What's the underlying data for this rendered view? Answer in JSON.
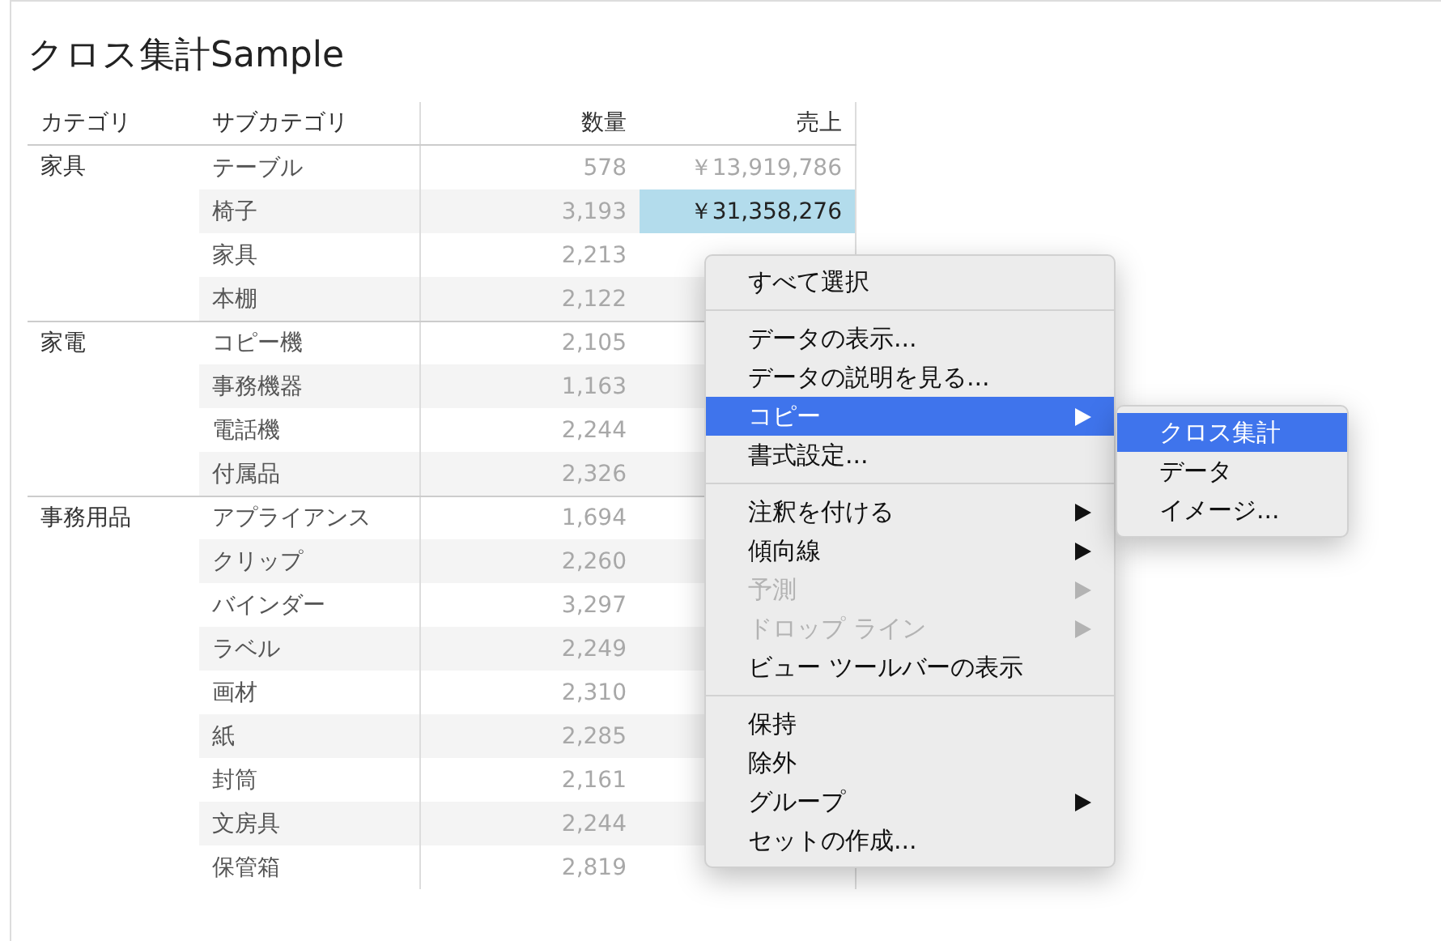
{
  "title": "クロス集計Sample",
  "table": {
    "columns": [
      "カテゴリ",
      "サブカテゴリ",
      "数量",
      "売上"
    ],
    "groups": [
      {
        "category": "家具",
        "rows": [
          {
            "subcategory": "テーブル",
            "quantity": "578",
            "sales": "￥13,919,786",
            "selected": false
          },
          {
            "subcategory": "椅子",
            "quantity": "3,193",
            "sales": "￥31,358,276",
            "selected": true
          },
          {
            "subcategory": "家具",
            "quantity": "2,213",
            "selected": false
          },
          {
            "subcategory": "本棚",
            "quantity": "2,122",
            "selected": false
          }
        ]
      },
      {
        "category": "家電",
        "rows": [
          {
            "subcategory": "コピー機",
            "quantity": "2,105",
            "selected": false
          },
          {
            "subcategory": "事務機器",
            "quantity": "1,163",
            "selected": false
          },
          {
            "subcategory": "電話機",
            "quantity": "2,244",
            "selected": false
          },
          {
            "subcategory": "付属品",
            "quantity": "2,326",
            "selected": false
          }
        ]
      },
      {
        "category": "事務用品",
        "rows": [
          {
            "subcategory": "アプライアンス",
            "quantity": "1,694",
            "selected": false
          },
          {
            "subcategory": "クリップ",
            "quantity": "2,260",
            "selected": false
          },
          {
            "subcategory": "バインダー",
            "quantity": "3,297",
            "selected": false
          },
          {
            "subcategory": "ラベル",
            "quantity": "2,249",
            "selected": false
          },
          {
            "subcategory": "画材",
            "quantity": "2,310",
            "selected": false
          },
          {
            "subcategory": "紙",
            "quantity": "2,285",
            "selected": false
          },
          {
            "subcategory": "封筒",
            "quantity": "2,161",
            "selected": false
          },
          {
            "subcategory": "文房具",
            "quantity": "2,244",
            "selected": false
          },
          {
            "subcategory": "保管箱",
            "quantity": "2,819",
            "selected": false
          }
        ]
      }
    ]
  },
  "context_menu": {
    "items": [
      {
        "kind": "item",
        "label": "すべて選択",
        "disabled": false,
        "selected": false,
        "submenu": false
      },
      {
        "kind": "separator"
      },
      {
        "kind": "item",
        "label": "データの表示...",
        "disabled": false,
        "selected": false,
        "submenu": false
      },
      {
        "kind": "item",
        "label": "データの説明を見る...",
        "disabled": false,
        "selected": false,
        "submenu": false
      },
      {
        "kind": "item",
        "label": "コピー",
        "disabled": false,
        "selected": true,
        "submenu": true
      },
      {
        "kind": "item",
        "label": "書式設定...",
        "disabled": false,
        "selected": false,
        "submenu": false
      },
      {
        "kind": "separator"
      },
      {
        "kind": "item",
        "label": "注釈を付ける",
        "disabled": false,
        "selected": false,
        "submenu": true
      },
      {
        "kind": "item",
        "label": "傾向線",
        "disabled": false,
        "selected": false,
        "submenu": true
      },
      {
        "kind": "item",
        "label": "予測",
        "disabled": true,
        "selected": false,
        "submenu": true
      },
      {
        "kind": "item",
        "label": "ドロップ ライン",
        "disabled": true,
        "selected": false,
        "submenu": true
      },
      {
        "kind": "item",
        "label": "ビュー ツールバーの表示",
        "disabled": false,
        "selected": false,
        "submenu": false
      },
      {
        "kind": "separator"
      },
      {
        "kind": "item",
        "label": "保持",
        "disabled": false,
        "selected": false,
        "submenu": false
      },
      {
        "kind": "item",
        "label": "除外",
        "disabled": false,
        "selected": false,
        "submenu": false
      },
      {
        "kind": "item",
        "label": "グループ",
        "disabled": false,
        "selected": false,
        "submenu": true
      },
      {
        "kind": "item",
        "label": "セットの作成...",
        "disabled": false,
        "selected": false,
        "submenu": false
      }
    ]
  },
  "submenu": {
    "items": [
      {
        "label": "クロス集計",
        "selected": true
      },
      {
        "label": "データ",
        "selected": false
      },
      {
        "label": "イメージ...",
        "selected": false
      }
    ]
  }
}
